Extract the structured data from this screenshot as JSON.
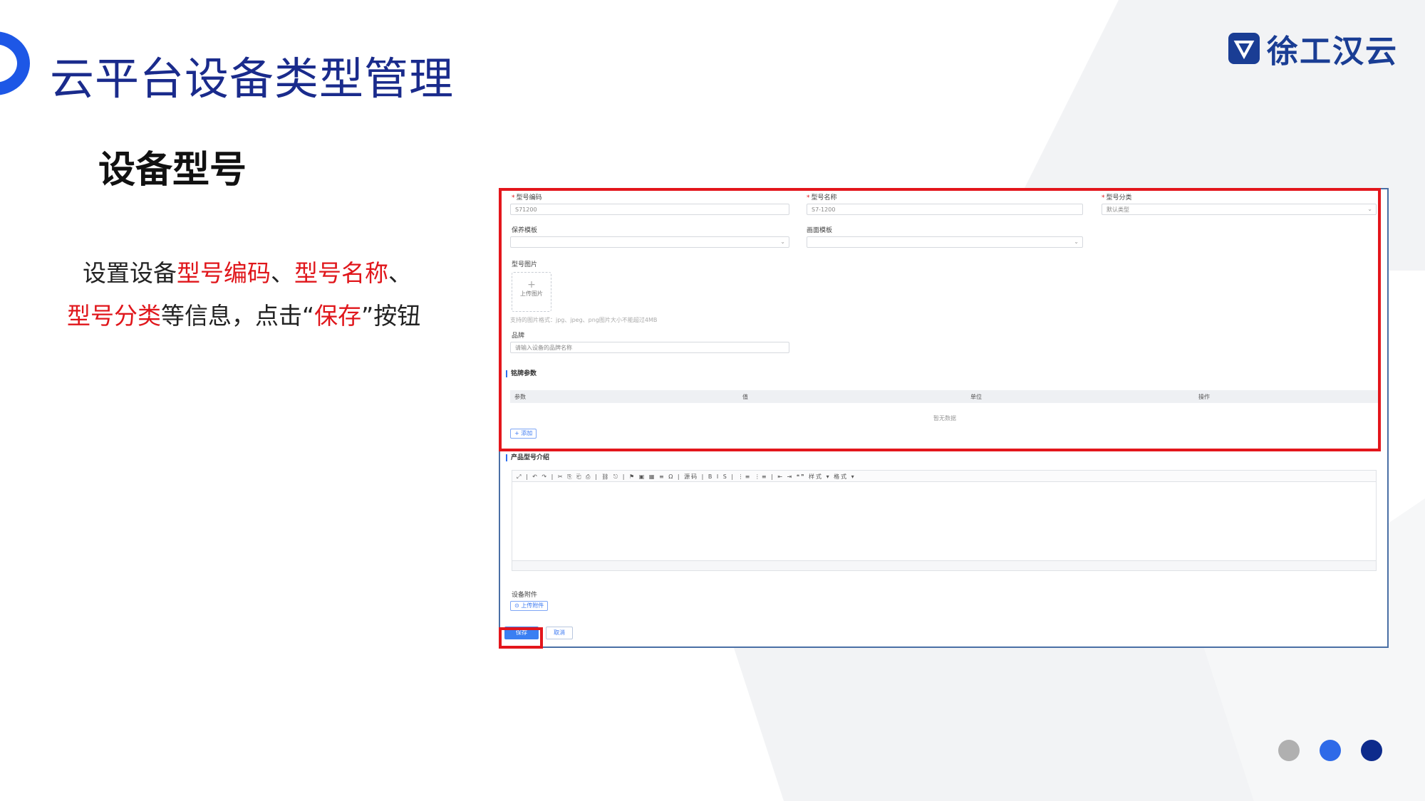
{
  "slide": {
    "title": "云平台设备类型管理",
    "brand": "徐工汉云",
    "section_title": "设备型号",
    "desc": {
      "p1": "设置设备",
      "h1": "型号编码",
      "p2": "、",
      "h2": "型号名称",
      "p3": "、",
      "h3": "型号分类",
      "p4": "等信息，点击“",
      "h4": "保存",
      "p5": "”按钮"
    },
    "colors": {
      "accent": "#1d57e6",
      "title": "#1a2b8c",
      "highlight": "#e0161b",
      "dot1": "#b0b0b0",
      "dot2": "#2e6ae8",
      "dot3": "#0d2b8c"
    }
  },
  "form": {
    "code_label": "型号编码",
    "code_value": "S71200",
    "name_label": "型号名称",
    "name_value": "S7-1200",
    "category_label": "型号分类",
    "category_value": "默认类型",
    "maintenance_label": "保养模板",
    "screen_label": "画面模板",
    "image_label": "型号图片",
    "upload_image": "上传图片",
    "image_hint": "支持的图片格式：jpg、jpeg、png图片大小不能超过4MB",
    "brand_label": "品牌",
    "brand_placeholder": "请输入设备的品牌名称",
    "nameplate_section": "铭牌参数",
    "columns": [
      "参数",
      "值",
      "单位",
      "操作"
    ],
    "empty_text": "暂无数据",
    "add_button": "+ 添加",
    "intro_section": "产品型号介绍",
    "toolbar_text": "⤢ | ↶ ↷ | ✂ ⎘ ⎗ ⎙ | ⛓ ⎋ | ⚑ ▣ ▦ ≡ Ω | 源码 | B I S | ⋮≡ ⋮≡ | ⇤ ⇥ ❝❞  样式 ▾  格式 ▾",
    "attachment_label": "设备附件",
    "upload_attachment": "⊙ 上传附件",
    "save_button": "保存",
    "cancel_button": "取消"
  }
}
